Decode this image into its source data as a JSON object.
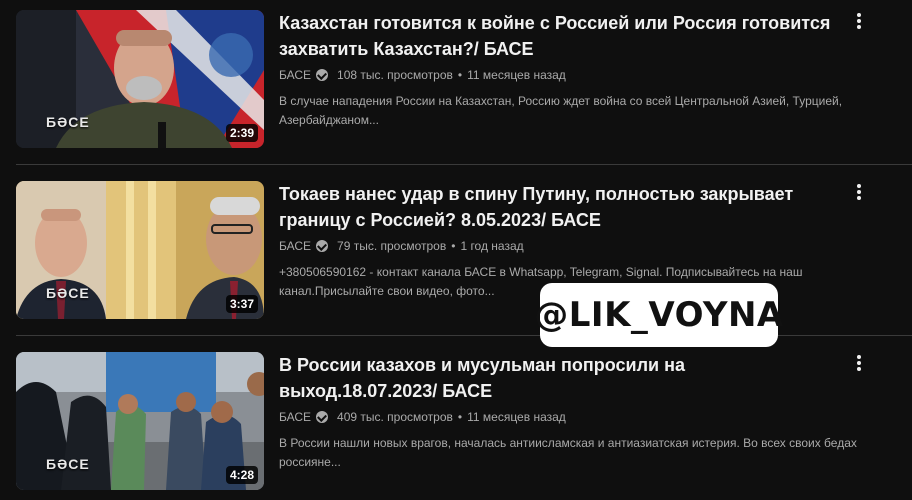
{
  "videos": [
    {
      "title": "Казахстан готовится к войне с Россией или Россия готовится захватить Казахстан?/ БАСЕ",
      "channel": "БАСЕ",
      "views": "108 тыс. просмотров",
      "age": "11 месяцев назад",
      "description": "В случае нападения России на Казахстан, Россию ждет война со всей Центральной Азией, Турцией, Азербайджаном...",
      "duration": "2:39",
      "thumb_brand": "БӘСЕ"
    },
    {
      "title": "Токаев нанес удар в спину Путину, полностью закрывает границу с Россией? 8.05.2023/ БАСЕ",
      "channel": "БАСЕ",
      "views": "79 тыс. просмотров",
      "age": "1 год назад",
      "description": "+380506590162 - контакт канала БАСЕ в Whatsapp, Telegram, Signal. Подписывайтесь на наш канал.Присылайте свои видео, фото...",
      "duration": "3:37",
      "thumb_brand": "БӘСЕ"
    },
    {
      "title": "В России казахов и мусульман попросили на выход.18.07.2023/ БАСЕ",
      "channel": "БАСЕ",
      "views": "409 тыс. просмотров",
      "age": "11 месяцев назад",
      "description": "В России нашли новых врагов, началась антиисламская и антиазиатская истерия. Во всех своих бедах россияне...",
      "duration": "4:28",
      "thumb_brand": "БӘСЕ"
    }
  ],
  "watermark": "@LIK_VOYNA"
}
